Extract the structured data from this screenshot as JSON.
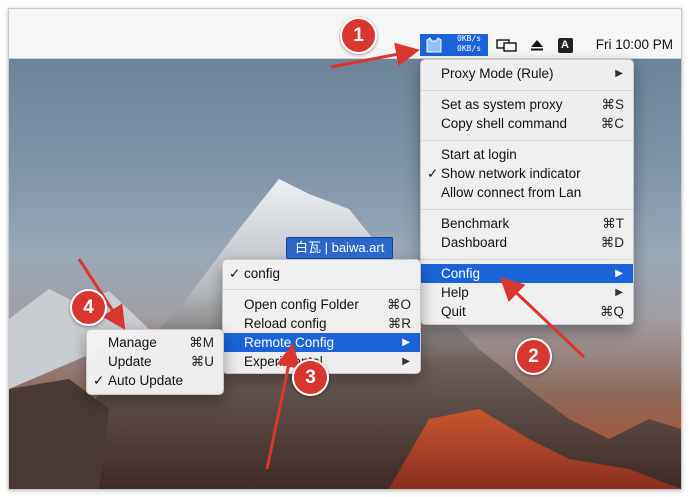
{
  "menubar": {
    "network_up": "0KB/s",
    "network_down": "0KB/s",
    "clock": "Fri 10:00 PM",
    "input_letter": "A"
  },
  "main_menu": {
    "items": [
      {
        "label": "Proxy Mode (Rule)",
        "shortcut": "",
        "submenu": true
      },
      {
        "label": "Set as system proxy",
        "shortcut": "⌘S"
      },
      {
        "label": "Copy shell command",
        "shortcut": "⌘C"
      },
      {
        "label": "Start at login",
        "shortcut": ""
      },
      {
        "label": "Show network indicator",
        "shortcut": "",
        "checked": true
      },
      {
        "label": "Allow connect from Lan",
        "shortcut": ""
      },
      {
        "label": "Benchmark",
        "shortcut": "⌘T"
      },
      {
        "label": "Dashboard",
        "shortcut": "⌘D"
      },
      {
        "label": "Config",
        "submenu": true,
        "selected": true
      },
      {
        "label": "Help",
        "submenu": true
      },
      {
        "label": "Quit",
        "shortcut": "⌘Q"
      }
    ]
  },
  "config_menu": {
    "items": [
      {
        "label": "config",
        "checked": true
      },
      {
        "label": "Open config Folder",
        "shortcut": "⌘O"
      },
      {
        "label": "Reload config",
        "shortcut": "⌘R"
      },
      {
        "label": "Remote Config",
        "submenu": true,
        "selected": true
      },
      {
        "label": "Experimental",
        "submenu": true
      }
    ]
  },
  "remote_menu": {
    "items": [
      {
        "label": "Manage",
        "shortcut": "⌘M"
      },
      {
        "label": "Update",
        "shortcut": "⌘U"
      },
      {
        "label": "Auto Update",
        "checked": true
      }
    ]
  },
  "watermark": "白瓦 | baiwa.art",
  "annotations": [
    "1",
    "2",
    "3",
    "4"
  ],
  "symbols": {
    "check": "✓",
    "arrow": "▶"
  },
  "colors": {
    "highlight": "#1a64d8",
    "badge": "#d93630",
    "arrow": "#d93630"
  },
  "icons": [
    "clashx-icon",
    "display-mirror-icon",
    "eject-icon",
    "input-source-icon"
  ]
}
